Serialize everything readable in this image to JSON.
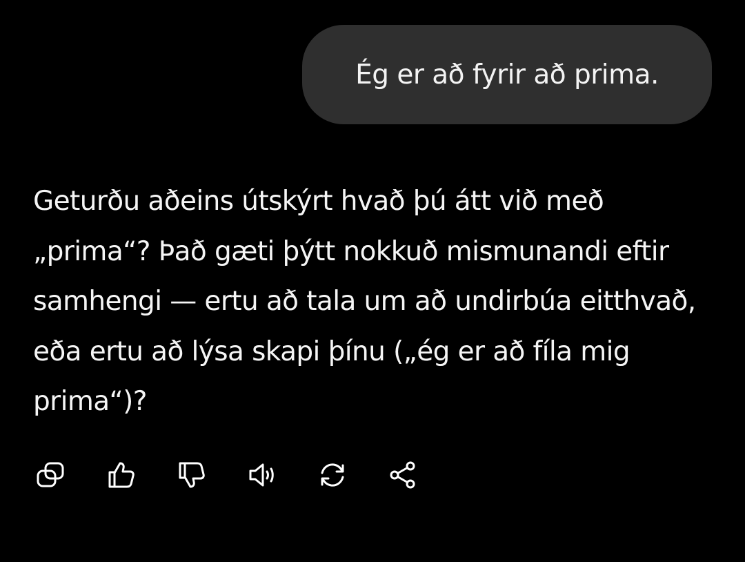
{
  "chat": {
    "user_message": "Ég er að fyrir að prima.",
    "assistant_reply": "Geturðu aðeins útskýrt hvað þú átt við með „prima“? Það gæti þýtt nokkuð mismunandi eftir samhengi — ertu að tala um að undirbúa eitthvað, eða ertu að lýsa skapi þínu („ég er að fíla mig prima“)?"
  },
  "actions": [
    {
      "icon": "copy-icon"
    },
    {
      "icon": "thumbs-up-icon"
    },
    {
      "icon": "thumbs-down-icon"
    },
    {
      "icon": "speaker-icon"
    },
    {
      "icon": "regenerate-icon"
    },
    {
      "icon": "share-icon"
    }
  ],
  "colors": {
    "background": "#000000",
    "user_bubble": "#2f2f2f",
    "text": "#ffffff"
  }
}
